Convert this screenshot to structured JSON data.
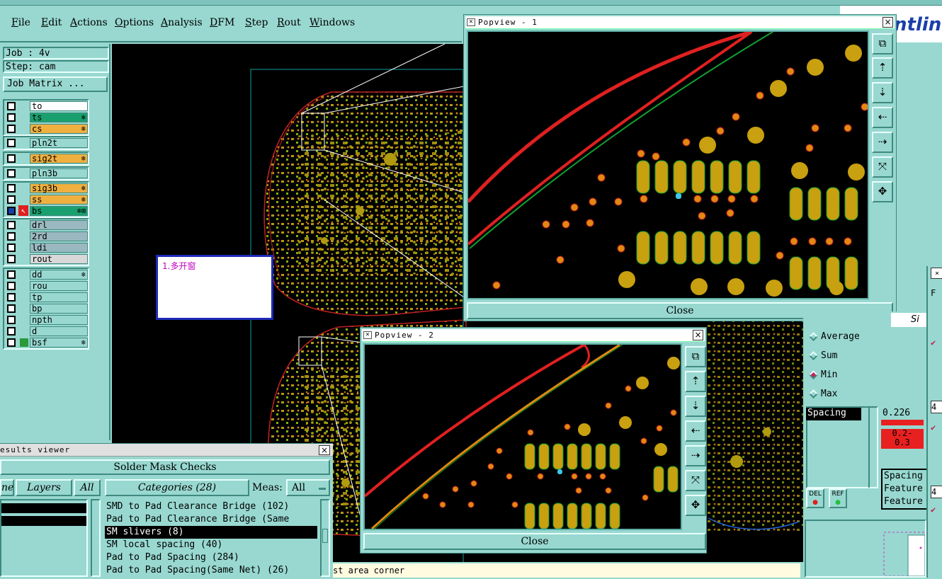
{
  "menu": {
    "items": [
      "File",
      "Edit",
      "Actions",
      "Options",
      "Analysis",
      "DFM",
      "Step",
      "Rout",
      "Windows"
    ]
  },
  "logo": {
    "text": "ntlin"
  },
  "job": {
    "job_label": "Job : 4v",
    "step_label": "Step: cam",
    "matrix_button": "Job Matrix ..."
  },
  "layers": {
    "group1": [
      {
        "name": "to",
        "color": "#ffffff",
        "sym": ""
      },
      {
        "name": "ts",
        "color": "#1aa06e",
        "sym": "❄"
      },
      {
        "name": "cs",
        "color": "#f0b040",
        "sym": "❄"
      }
    ],
    "group2": [
      {
        "name": "pln2t",
        "color": "#98d8d0",
        "sym": ""
      }
    ],
    "group3": [
      {
        "name": "sig2t",
        "color": "#f0b040",
        "sym": "❄"
      }
    ],
    "group4": [
      {
        "name": "pln3b",
        "color": "#98d8d0",
        "sym": ""
      }
    ],
    "group5": [
      {
        "name": "sig3b",
        "color": "#f0b040",
        "sym": "❄"
      },
      {
        "name": "ss",
        "color": "#f0b040",
        "sym": "❄"
      },
      {
        "name": "bs",
        "color": "#1aa06e",
        "sym": "❄⊞"
      }
    ],
    "group6": [
      {
        "name": "drl",
        "color": "#9ab8c0",
        "sym": ""
      },
      {
        "name": "2rd",
        "color": "#9ab8c0",
        "sym": ""
      },
      {
        "name": "ldi",
        "color": "#9ab8c0",
        "sym": ""
      },
      {
        "name": "rout",
        "color": "#d8d8d8",
        "sym": ""
      }
    ],
    "group7": [
      {
        "name": "dd",
        "color": "#98d8d0",
        "sym": "❄"
      },
      {
        "name": "rou",
        "color": "#98d8d0",
        "sym": ""
      },
      {
        "name": "tp",
        "color": "#98d8d0",
        "sym": ""
      },
      {
        "name": "bp",
        "color": "#98d8d0",
        "sym": ""
      },
      {
        "name": "npth",
        "color": "#98d8d0",
        "sym": ""
      },
      {
        "name": "d",
        "color": "#98d8d0",
        "sym": ""
      },
      {
        "name": "bsf",
        "color": "#98d8d0",
        "sym": "❄"
      }
    ]
  },
  "note": {
    "text": "1.多开窗"
  },
  "popview1": {
    "title": "Popview - 1",
    "close_label": "Close"
  },
  "popview2": {
    "title": "Popview - 2",
    "close_label": "Close"
  },
  "results": {
    "title": "esults viewer",
    "section": "Solder Mask Checks",
    "tab_one": "ne",
    "tab_layers": "Layers",
    "tab_all": "All",
    "categories_header": "Categories (28)",
    "meas_label": "Meas:",
    "meas_value": "All",
    "categories": [
      {
        "text": "SMD to Pad Clearance Bridge (102)",
        "selected": false
      },
      {
        "text": "Pad to Pad Clearance Bridge (Same",
        "selected": false
      },
      {
        "text": "SM slivers (8)",
        "selected": true
      },
      {
        "text": "SM local spacing (40)",
        "selected": false
      },
      {
        "text": "Pad to Pad Spacing (284)",
        "selected": false
      },
      {
        "text": "Pad to Pad Spacing(Same Net) (26)",
        "selected": false
      }
    ]
  },
  "status_bar": {
    "text": "st area corner"
  },
  "stats": {
    "options": [
      "Average",
      "Sum",
      "Min",
      "Max"
    ],
    "selected": "Min",
    "spacing_label": "Spacing",
    "hist_value": "0.226",
    "hist_range": "0.2-\n0.3",
    "si_label": "Si",
    "del_label": "DEL",
    "ref_label": "REF",
    "info_lines": [
      "Spacing",
      "Feature",
      "Feature"
    ]
  },
  "colors": {
    "panel": "#98d8d0",
    "copper": "#b09a10",
    "pad_red": "#e02020",
    "orange": "#e08a10",
    "outline": "#10a030"
  }
}
